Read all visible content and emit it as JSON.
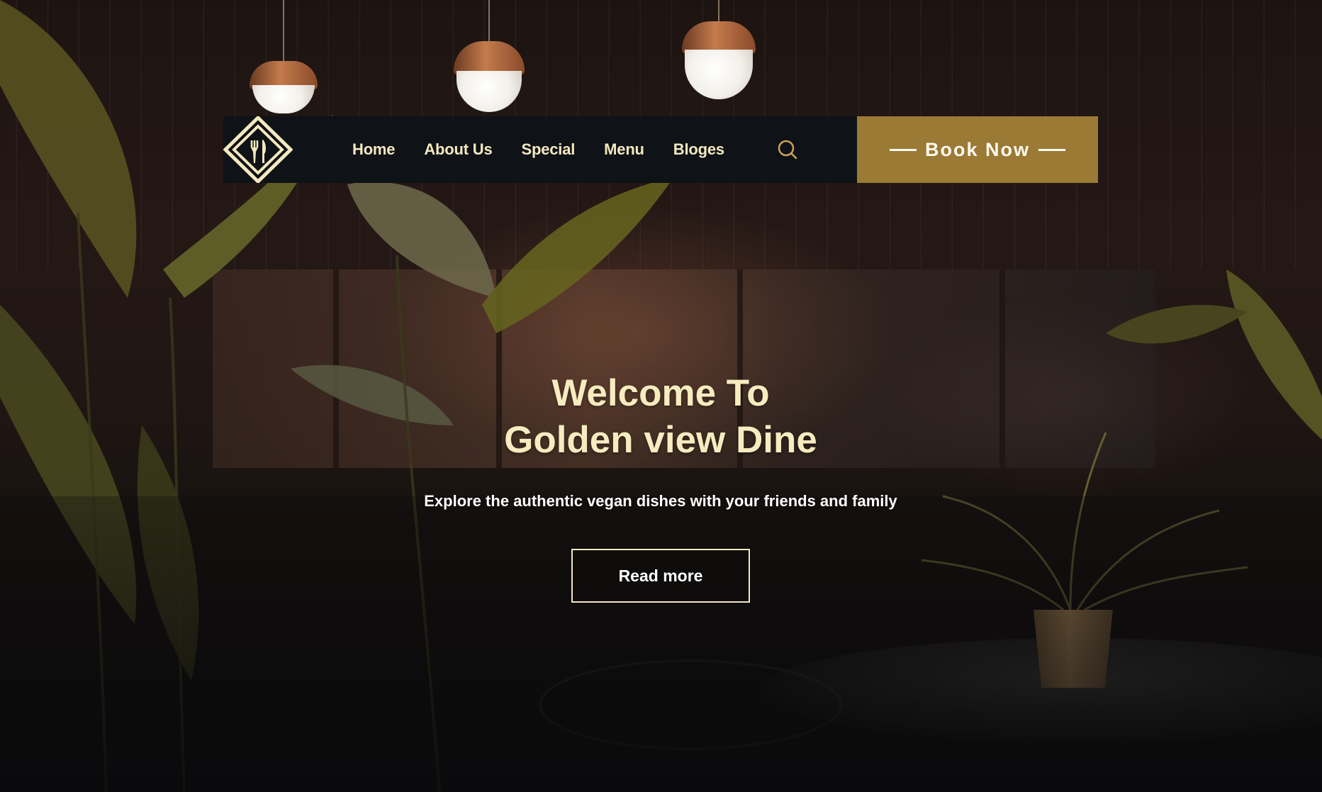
{
  "nav": {
    "logo_icon": "fork-knife-diamond-icon",
    "items": [
      {
        "label": "Home"
      },
      {
        "label": "About Us"
      },
      {
        "label": "Special"
      },
      {
        "label": "Menu"
      },
      {
        "label": "Bloges"
      }
    ],
    "search_icon": "search-icon",
    "book_now_label": "Book Now"
  },
  "hero": {
    "title_line1": "Welcome To",
    "title_line2": "Golden view Dine",
    "subtitle": "Explore the authentic vegan dishes with your friends and family",
    "cta_label": "Read more"
  },
  "colors": {
    "nav_background": "#0f1216",
    "accent_gold": "#9b7a35",
    "nav_text": "#f4e8bf",
    "hero_title": "#f6ecbf",
    "hero_subtitle": "#ffffff"
  }
}
